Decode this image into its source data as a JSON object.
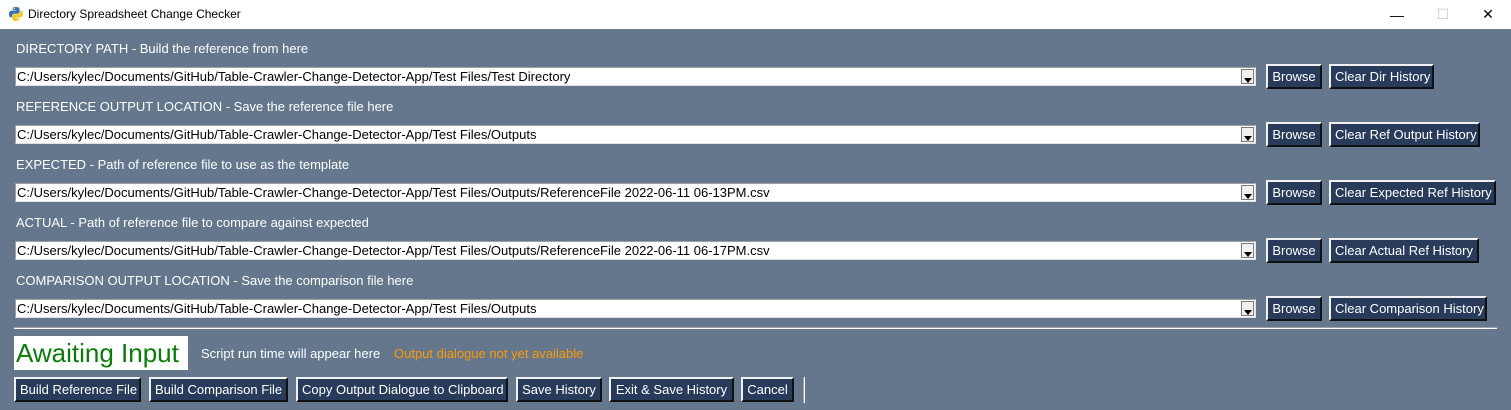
{
  "window": {
    "title": "Directory Spreadsheet Change Checker",
    "min_glyph": "—",
    "max_glyph": "☐",
    "close_glyph": "✕",
    "icon": "python-icon"
  },
  "rows": [
    {
      "label": "DIRECTORY PATH - Build the reference from here",
      "value": "C:/Users/kylec/Documents/GitHub/Table-Crawler-Change-Detector-App/Test Files/Test Directory",
      "browse_label": "Browse",
      "clear_label": "Clear Dir History"
    },
    {
      "label": "REFERENCE OUTPUT LOCATION - Save the reference file here",
      "value": "C:/Users/kylec/Documents/GitHub/Table-Crawler-Change-Detector-App/Test Files/Outputs",
      "browse_label": "Browse",
      "clear_label": "Clear Ref Output History"
    },
    {
      "label": "EXPECTED - Path of reference file to use as the template",
      "value": "C:/Users/kylec/Documents/GitHub/Table-Crawler-Change-Detector-App/Test Files/Outputs/ReferenceFile 2022-06-11 06-13PM.csv",
      "browse_label": "Browse",
      "clear_label": "Clear Expected Ref History"
    },
    {
      "label": "ACTUAL - Path of reference file to compare against expected",
      "value": "C:/Users/kylec/Documents/GitHub/Table-Crawler-Change-Detector-App/Test Files/Outputs/ReferenceFile 2022-06-11 06-17PM.csv",
      "browse_label": "Browse",
      "clear_label": "Clear Actual Ref History"
    },
    {
      "label": "COMPARISON OUTPUT LOCATION - Save the comparison file here",
      "value": "C:/Users/kylec/Documents/GitHub/Table-Crawler-Change-Detector-App/Test Files/Outputs",
      "browse_label": "Browse",
      "clear_label": "Clear Comparison History"
    }
  ],
  "status": {
    "state_text": "Awaiting Input",
    "run_time_text": "Script run time will appear here",
    "output_text": "Output dialogue not yet available"
  },
  "actions": {
    "build_reference": "Build Reference File",
    "build_comparison": "Build Comparison File",
    "copy_output": "Copy Output Dialogue to Clipboard",
    "save_history": "Save History",
    "exit_save": "Exit & Save History",
    "cancel": "Cancel"
  },
  "colors": {
    "background": "#64778d",
    "button": "#283b5b",
    "status_green": "#0a7a0a",
    "output_orange": "#ff9a00"
  }
}
